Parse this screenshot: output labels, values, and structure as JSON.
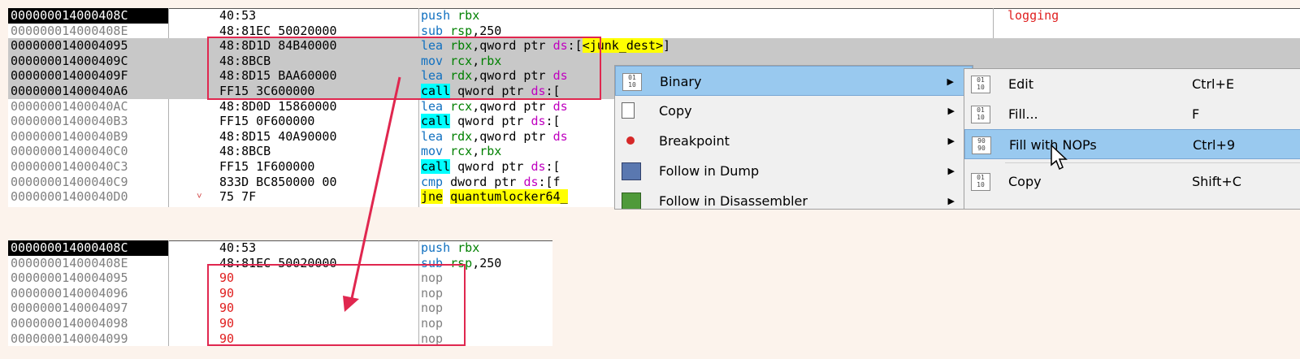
{
  "top_listing": {
    "rows": [
      {
        "addr": "000000014000408C",
        "mark": "",
        "bytes": "40:53",
        "mnemonic": "push",
        "operands": "rbx",
        "cur": true,
        "sel": false,
        "comment": "logging"
      },
      {
        "addr": "000000014000408E",
        "mark": "",
        "bytes": "48:81EC 50020000",
        "mnemonic": "sub",
        "operands": "rsp,250",
        "cur": false,
        "sel": false
      },
      {
        "addr": "0000000140004095",
        "mark": "",
        "bytes": "48:8D1D 84B40000",
        "mnemonic": "lea",
        "operands": "rbx,qword ptr ds:[<junk_dest>]",
        "cur": false,
        "sel": true
      },
      {
        "addr": "000000014000409C",
        "mark": "",
        "bytes": "48:8BCB",
        "mnemonic": "mov",
        "operands": "rcx,rbx",
        "cur": false,
        "sel": true
      },
      {
        "addr": "000000014000409F",
        "mark": "",
        "bytes": "48:8D15 BAA60000",
        "mnemonic": "lea",
        "operands": "rdx,qword ptr ds",
        "cur": false,
        "sel": true
      },
      {
        "addr": "00000001400040A6",
        "mark": "",
        "bytes": "FF15 3C600000",
        "mnemonic": "call",
        "operands": "qword ptr ds:[<",
        "cur": false,
        "sel": true
      },
      {
        "addr": "00000001400040AC",
        "mark": "",
        "bytes": "48:8D0D 15860000",
        "mnemonic": "lea",
        "operands": "rcx,qword ptr ds",
        "cur": false,
        "sel": false
      },
      {
        "addr": "00000001400040B3",
        "mark": "",
        "bytes": "FF15 0F600000",
        "mnemonic": "call",
        "operands": "qword ptr ds:[<",
        "cur": false,
        "sel": false
      },
      {
        "addr": "00000001400040B9",
        "mark": "",
        "bytes": "48:8D15 40A90000",
        "mnemonic": "lea",
        "operands": "rdx,qword ptr ds",
        "cur": false,
        "sel": false
      },
      {
        "addr": "00000001400040C0",
        "mark": "",
        "bytes": "48:8BCB",
        "mnemonic": "mov",
        "operands": "rcx,rbx",
        "cur": false,
        "sel": false
      },
      {
        "addr": "00000001400040C3",
        "mark": "",
        "bytes": "FF15 1F600000",
        "mnemonic": "call",
        "operands": "qword ptr ds:[<",
        "cur": false,
        "sel": false
      },
      {
        "addr": "00000001400040C9",
        "mark": "",
        "bytes": "833D BC850000 00",
        "mnemonic": "cmp",
        "operands": "dword ptr ds:[<f",
        "cur": false,
        "sel": false
      },
      {
        "addr": "00000001400040D0",
        "mark": "˅",
        "bytes": "75 7F",
        "mnemonic": "jne",
        "operands": "quantumlocker64_",
        "cur": false,
        "sel": false
      }
    ]
  },
  "bottom_listing": {
    "rows": [
      {
        "addr": "000000014000408C",
        "bytes": "40:53",
        "mnemonic": "push",
        "operands": "rbx",
        "cur": true
      },
      {
        "addr": "000000014000408E",
        "bytes": "48:81EC 50020000",
        "mnemonic": "sub",
        "operands": "rsp,250",
        "cur": false
      },
      {
        "addr": "0000000140004095",
        "bytes": "90",
        "mnemonic": "nop",
        "operands": "",
        "cur": false
      },
      {
        "addr": "0000000140004096",
        "bytes": "90",
        "mnemonic": "nop",
        "operands": "",
        "cur": false
      },
      {
        "addr": "0000000140004097",
        "bytes": "90",
        "mnemonic": "nop",
        "operands": "",
        "cur": false
      },
      {
        "addr": "0000000140004098",
        "bytes": "90",
        "mnemonic": "nop",
        "operands": "",
        "cur": false
      },
      {
        "addr": "0000000140004099",
        "bytes": "90",
        "mnemonic": "nop",
        "operands": "",
        "cur": false
      }
    ]
  },
  "context_menu": {
    "items": [
      {
        "label": "Binary",
        "icon": "binary-icon",
        "has_submenu": true,
        "hover": true
      },
      {
        "label": "Copy",
        "icon": "copy-icon",
        "has_submenu": true,
        "hover": false
      },
      {
        "label": "Breakpoint",
        "icon": "breakpoint-icon",
        "has_submenu": true,
        "hover": false
      },
      {
        "label": "Follow in Dump",
        "icon": "follow-dump-icon",
        "has_submenu": true,
        "hover": false
      },
      {
        "label": "Follow in Disassembler",
        "icon": "follow-disassembler-icon",
        "has_submenu": true,
        "hover": false
      }
    ]
  },
  "sub_menu": {
    "items": [
      {
        "label": "Edit",
        "shortcut": "Ctrl+E",
        "icon": "edit-binary-icon",
        "hover": false
      },
      {
        "label": "Fill...",
        "shortcut": "F",
        "icon": "fill-icon",
        "hover": false
      },
      {
        "label": "Fill with NOPs",
        "shortcut": "Ctrl+9",
        "icon": "fill-nops-icon",
        "hover": true
      },
      {
        "label": "Copy",
        "shortcut": "Shift+C",
        "icon": "copy-binary-icon",
        "hover": false
      }
    ]
  },
  "colors": {
    "annotation_red": "#e0274f",
    "selection_gray": "#c8c8c8",
    "menu_hover": "#99c9ef",
    "page_bg": "#fcf3ec"
  }
}
